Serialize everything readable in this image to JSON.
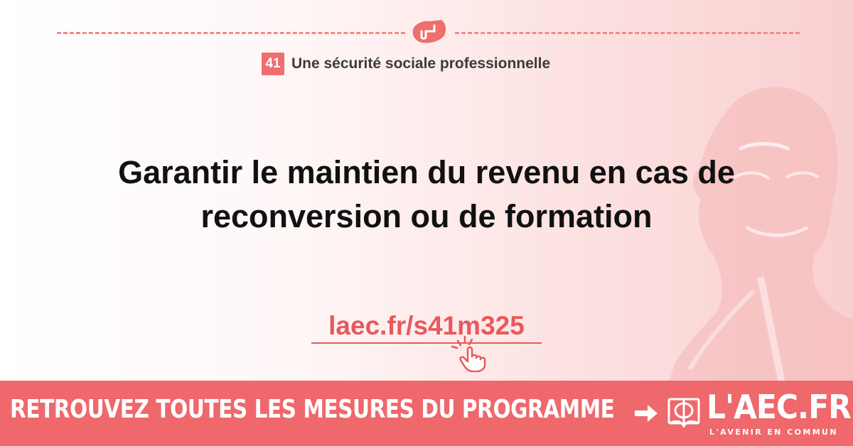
{
  "category": {
    "number": "41",
    "label": "Une sécurité sociale professionnelle"
  },
  "headline": {
    "line1": "Garantir le maintien du revenu en cas de",
    "line2": "reconversion ou de formation"
  },
  "link": {
    "text": "laec.fr/s41m325"
  },
  "banner": {
    "cta": "RETROUVEZ TOUTES LES MESURES DU PROGRAMME",
    "logo_text": "L'AEC.FR",
    "logo_tagline": "L'AVENIR EN COMMUN"
  },
  "icons": {
    "top": "handshake-icon",
    "link": "click-hand-icon",
    "arrow": "arrow-right-icon",
    "logo": "phi-book-icon"
  },
  "colors": {
    "accent": "#ee686c",
    "link": "#e8595b",
    "headline": "#111111",
    "banner_text": "#ffffff"
  }
}
